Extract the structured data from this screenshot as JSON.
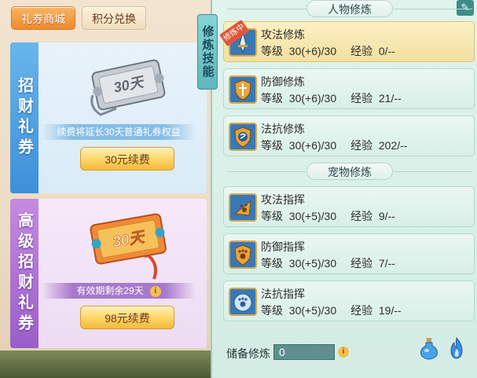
{
  "left": {
    "tabs": [
      {
        "label": "礼券商城",
        "active": true
      },
      {
        "label": "积分兑换",
        "active": false
      }
    ],
    "cards": [
      {
        "side_label": "招财礼券",
        "voucher_text": "30天",
        "info": "续费将延长30天普通礼券权益",
        "button": "30元续费",
        "theme": "blue"
      },
      {
        "side_label": "高级招财礼券",
        "voucher_text": "30天",
        "info": "有效期剩余29天",
        "info_icon": "i",
        "button": "98元续费",
        "theme": "purple"
      }
    ]
  },
  "right": {
    "vertical_tab": "修炼技能",
    "sections": [
      {
        "title": "人物修炼",
        "skills": [
          {
            "name": "攻法修炼",
            "level_label": "等级",
            "level": "30(+6)/30",
            "exp_label": "经验",
            "exp": "0/--",
            "badge": "修炼中",
            "selected": true,
            "icon": "sword-icon"
          },
          {
            "name": "防御修炼",
            "level_label": "等级",
            "level": "30(+6)/30",
            "exp_label": "经验",
            "exp": "21/--",
            "selected": false,
            "icon": "shield-icon"
          },
          {
            "name": "法抗修炼",
            "level_label": "等级",
            "level": "30(+6)/30",
            "exp_label": "经验",
            "exp": "202/--",
            "selected": false,
            "icon": "magic-shield-icon"
          }
        ]
      },
      {
        "title": "宠物修炼",
        "skills": [
          {
            "name": "攻法指挥",
            "level_label": "等级",
            "level": "30(+5)/30",
            "exp_label": "经验",
            "exp": "9/--",
            "selected": false,
            "icon": "paw-attack-icon"
          },
          {
            "name": "防御指挥",
            "level_label": "等级",
            "level": "30(+5)/30",
            "exp_label": "经验",
            "exp": "7/--",
            "selected": false,
            "icon": "paw-defense-icon"
          },
          {
            "name": "法抗指挥",
            "level_label": "等级",
            "level": "30(+5)/30",
            "exp_label": "经验",
            "exp": "19/--",
            "selected": false,
            "icon": "paw-resist-icon"
          }
        ]
      }
    ],
    "footer": {
      "label": "储备修炼",
      "value": "0",
      "info_icon": "i"
    }
  },
  "colors": {
    "accent_orange": "#ee8a2e",
    "blue_card": "#3d8fd8",
    "purple_card": "#9a5ec9",
    "panel_teal": "#d3ece4"
  }
}
